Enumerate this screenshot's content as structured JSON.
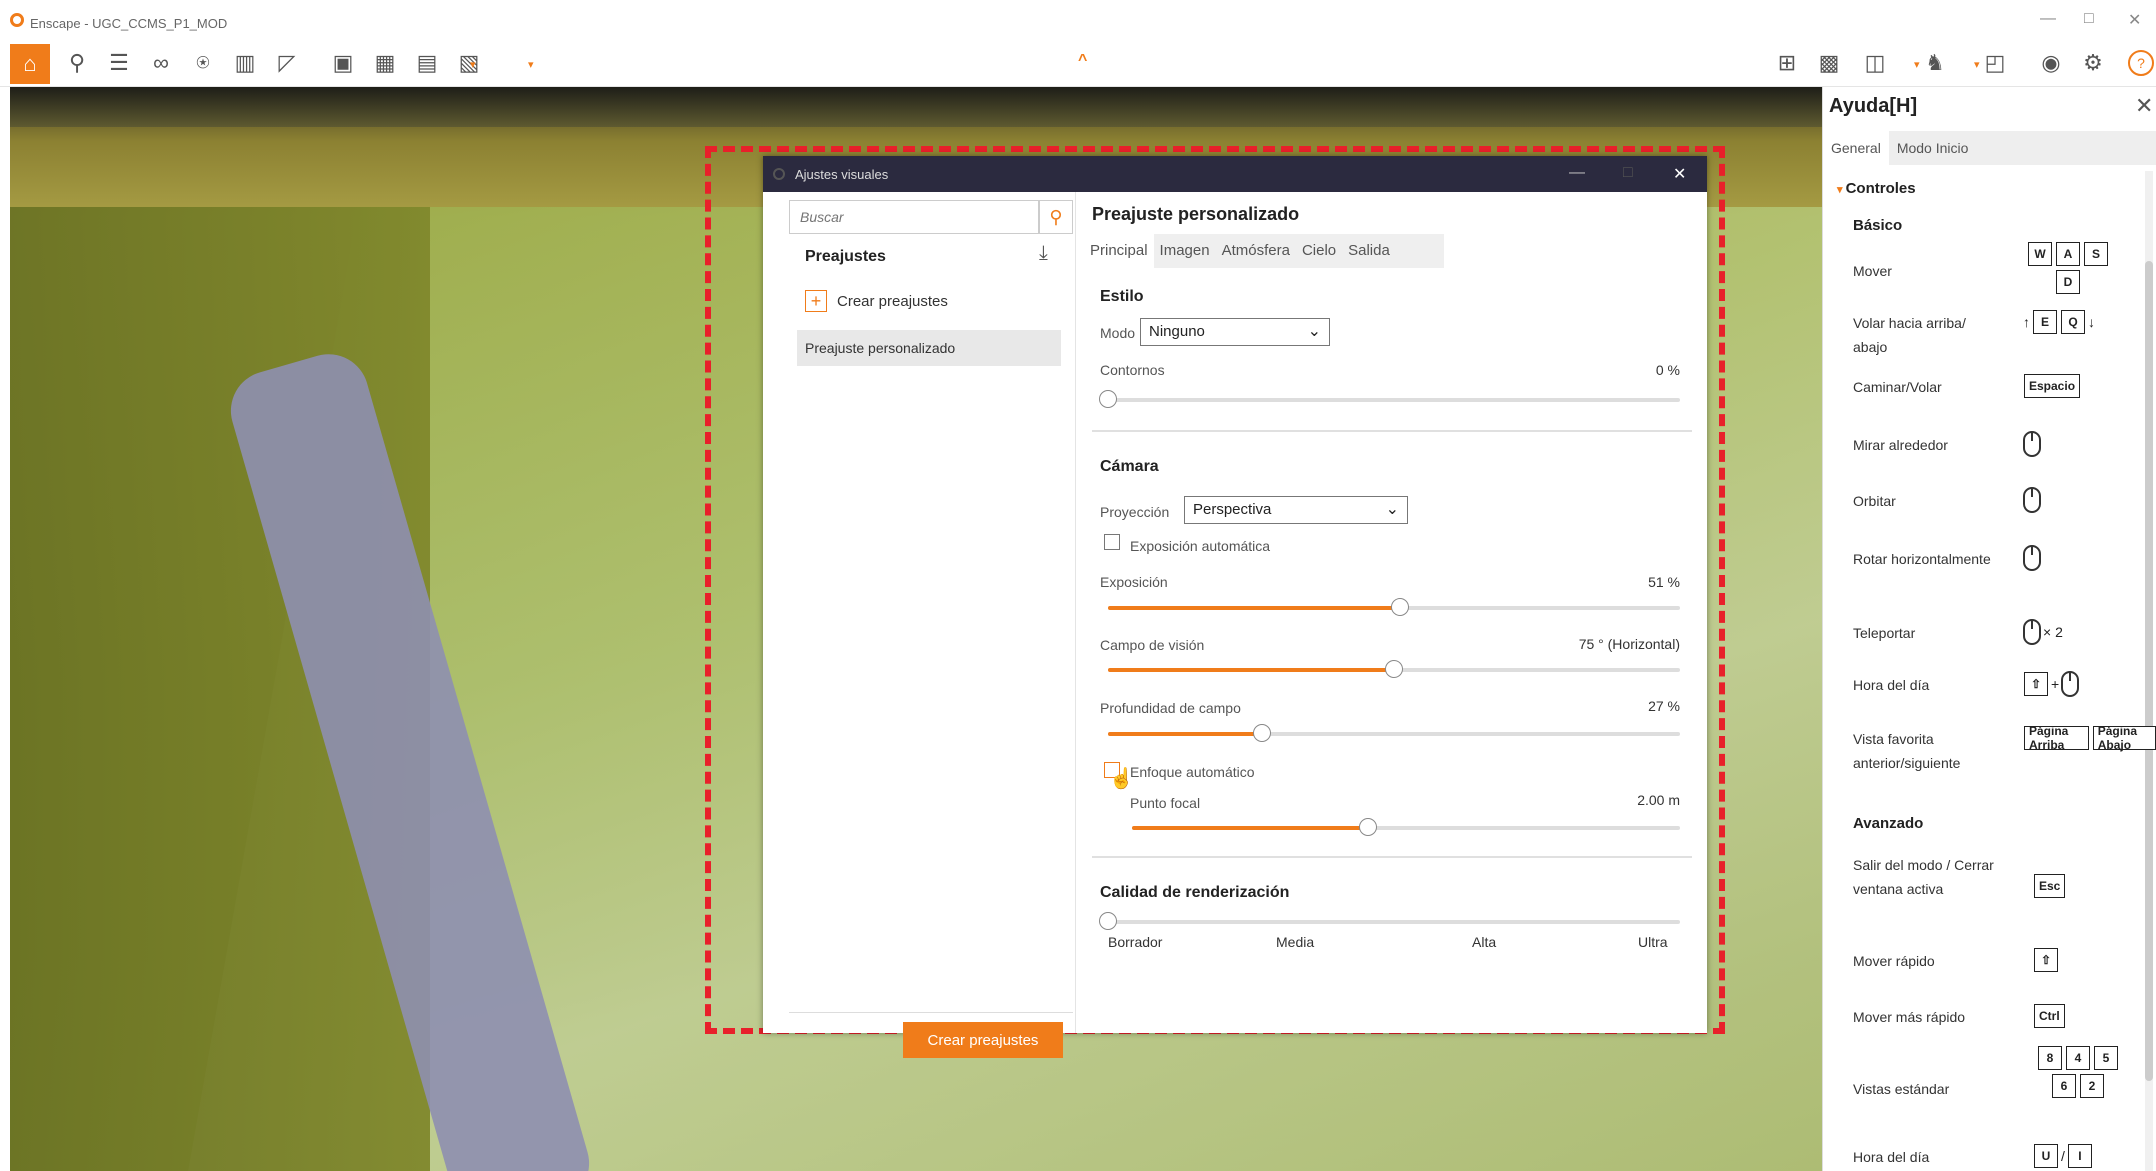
{
  "window": {
    "title": "Enscape - UGC_CCMS_P1_MOD",
    "minimize": "—",
    "restore": "□",
    "close": "✕"
  },
  "toolbar": {
    "home_icon": "⌂",
    "left_icons": [
      {
        "name": "pin-icon",
        "glyph": "⚲"
      },
      {
        "name": "bim-icon",
        "glyph": "☰"
      },
      {
        "name": "binoculars-icon",
        "glyph": "∞"
      },
      {
        "name": "orbit-icon",
        "glyph": "⍟"
      },
      {
        "name": "building-icon",
        "glyph": "▥"
      },
      {
        "name": "sections-icon",
        "glyph": "◸"
      },
      {
        "name": "export-image-icon",
        "glyph": "▣"
      },
      {
        "name": "export-panorama-icon",
        "glyph": "▦"
      },
      {
        "name": "export-video-icon",
        "glyph": "▤"
      },
      {
        "name": "export-exe-icon",
        "glyph": "▧"
      }
    ],
    "collapse_caret": "^",
    "right_icons": [
      {
        "name": "map-icon",
        "glyph": "⊞"
      },
      {
        "name": "image-icon",
        "glyph": "▩"
      },
      {
        "name": "box-icon",
        "glyph": "◫"
      },
      {
        "name": "people-icon",
        "glyph": "♞"
      },
      {
        "name": "vr-icon",
        "glyph": "◰"
      },
      {
        "name": "eye-icon",
        "glyph": "◉"
      },
      {
        "name": "gear-icon",
        "glyph": "⚙"
      }
    ],
    "help_icon": "?"
  },
  "dialog": {
    "title": "Ajustes visuales",
    "minimize": "—",
    "restore": "□",
    "close": "✕",
    "search_placeholder": "Buscar",
    "presets_header": "Preajustes",
    "import_icon": "⤓",
    "create_link": "Crear preajustes",
    "preset_items": [
      "Preajuste personalizado"
    ],
    "create_button": "Crear preajustes",
    "panel_title": "Preajuste personalizado",
    "tabs": [
      "Principal",
      "Imagen",
      "Atmósfera",
      "Cielo",
      "Salida"
    ],
    "style": {
      "header": "Estilo",
      "mode_label": "Modo",
      "mode_value": "Ninguno",
      "contours_label": "Contornos",
      "contours_value": "0 %",
      "contours_level": 0
    },
    "camera": {
      "header": "Cámara",
      "projection_label": "Proyección",
      "projection_value": "Perspectiva",
      "auto_exposure_label": "Exposición automática",
      "auto_exposure_checked": false,
      "exposure_label": "Exposición",
      "exposure_value": "51 %",
      "exposure_level": 0.51,
      "fov_label": "Campo de visión",
      "fov_value": "75 ° (Horizontal)",
      "fov_level": 0.5,
      "dof_label": "Profundidad de campo",
      "dof_value": "27 %",
      "dof_level": 0.27,
      "autofocus_label": "Enfoque automático",
      "autofocus_checked": false,
      "focal_label": "Punto focal",
      "focal_value": "2.00 m",
      "focal_level": 0.43
    },
    "render": {
      "header": "Calidad de renderización",
      "level": 0,
      "ticks": [
        "Borrador",
        "Media",
        "Alta",
        "Ultra"
      ]
    }
  },
  "help": {
    "title": "Ayuda[H]",
    "close": "✕",
    "tabs": [
      "General",
      "Modo Inicio"
    ],
    "controls_header": "Controles",
    "basic_header": "Básico",
    "basic_rows": [
      {
        "label": "Mover",
        "keys": [
          "W",
          "A",
          "S",
          "D"
        ]
      },
      {
        "label": "Volar hacia arriba/ abajo",
        "keys": [
          "↑",
          "E",
          "Q",
          "↓"
        ]
      },
      {
        "label": "Caminar/Volar",
        "keys": [
          "Espacio"
        ]
      },
      {
        "label": "Mirar alrededor",
        "keys": []
      },
      {
        "label": "Orbitar",
        "keys": []
      },
      {
        "label": "Rotar horizontalmente",
        "keys": []
      },
      {
        "label": "Teleportar",
        "keys": [
          "× 2"
        ]
      },
      {
        "label": "Hora del día",
        "keys": [
          "⇧",
          "+"
        ]
      },
      {
        "label": "Vista favorita anterior/siguiente",
        "keys": [
          "Página Arriba",
          "Página Abajo"
        ]
      }
    ],
    "advanced_header": "Avanzado",
    "advanced_rows": [
      {
        "label": "Salir del modo / Cerrar ventana activa",
        "keys": [
          "Esc"
        ]
      },
      {
        "label": "Mover rápido",
        "keys": [
          "⇧"
        ]
      },
      {
        "label": "Mover más rápido",
        "keys": [
          "Ctrl"
        ]
      },
      {
        "label": "Vistas estándar",
        "keys": [
          "8",
          "4",
          "5",
          "6",
          "2"
        ]
      },
      {
        "label": "Hora del día",
        "keys": [
          "U",
          "/",
          "I"
        ]
      }
    ]
  },
  "colors": {
    "accent": "#f07c1a",
    "highlight": "#e8202a",
    "dialog_title_bg": "#2b2a3f"
  }
}
